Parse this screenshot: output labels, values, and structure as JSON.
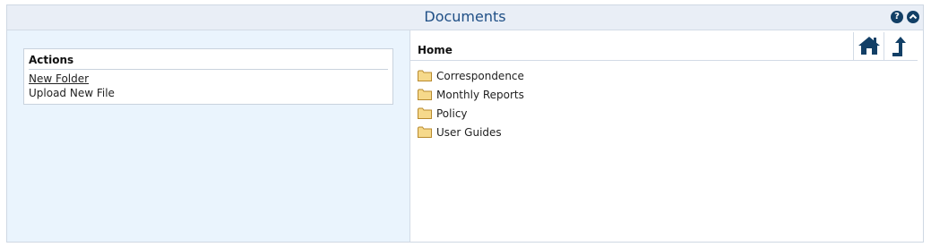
{
  "header": {
    "title": "Documents",
    "help_icon": "help-icon",
    "collapse_icon": "collapse-icon"
  },
  "actions": {
    "title": "Actions",
    "items": [
      {
        "label": "New Folder"
      },
      {
        "label": "Upload New File"
      }
    ]
  },
  "browser": {
    "title": "Home",
    "home_icon": "home-icon",
    "up_icon": "up-directory-icon",
    "folders": [
      {
        "label": "Correspondence"
      },
      {
        "label": "Monthly Reports"
      },
      {
        "label": "Policy"
      },
      {
        "label": "User Guides"
      }
    ]
  },
  "colors": {
    "header_bg": "#e9eef6",
    "title_color": "#1f4f86",
    "left_pane_bg": "#eaf4fd",
    "icon_dark": "#123f66",
    "folder_fill": "#f6d98b"
  }
}
